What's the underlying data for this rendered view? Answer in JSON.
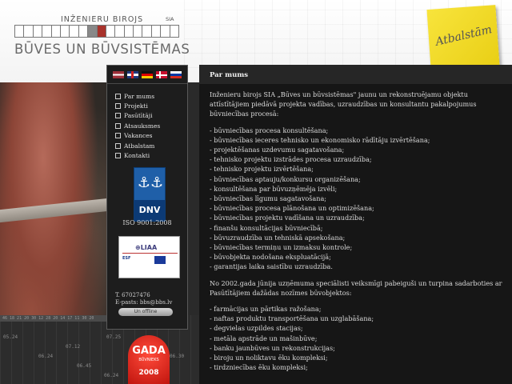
{
  "header": {
    "logo_top": "INŽENIERU BIROJS",
    "logo_sia": "SIA",
    "logo_bottom": "BŪVES UN BŪVSISTĒMAS",
    "sticky_note": "Atbalstām"
  },
  "nav": {
    "flags": [
      "lv",
      "gb",
      "de",
      "dk",
      "ru"
    ],
    "menu": [
      "Par mums",
      "Projekti",
      "Pasūtītāji",
      "Atsauksmes",
      "Vakances",
      "Atbalstam",
      "Kontakti"
    ],
    "dnv": {
      "anchors": "⚓⚓",
      "label": "DNV"
    },
    "iso": "ISO 9001:2008",
    "liaa": {
      "logo": "⊕LIAA",
      "esf": "ESF"
    },
    "contact": {
      "phone": "T. 67027476",
      "email": "E-pasts: bbs@bbs.lv"
    },
    "online_button": "Un offline"
  },
  "badge": {
    "title": "GADA",
    "subtitle": "BŪVNIEKS",
    "year": "2008"
  },
  "content": {
    "title": "Par mums",
    "intro": "Inženieru birojs SIA „Būves un būvsistēmas\" jaunu un rekonstruējamu objektu attīstītājiem piedāvā projekta vadības, uzraudzības un konsultantu pakalpojumus būvniecības procesā:",
    "services": [
      "- būvniecības procesa konsultēšana;",
      "- būvniecības ieceres tehnisko un ekonomisko rādītāju izvērtēšana;",
      "- projektēšanas uzdevumu sagatavošana;",
      "- tehnisko projektu izstrādes procesa uzraudzība;",
      "- tehnisko projektu izvērtēšana;",
      "- būvniecības aptauju/konkursu organizēšana;",
      "- konsultēšana par būvuzņēmēja izvēli;",
      "- būvniecības līgumu sagatavošana;",
      "- būvniecības procesa plānošana un optimizēšana;",
      "- būvniecības projektu vadīšana un uzraudzība;",
      "- finanšu konsultācijas būvniecībā;",
      "- būvuzraudzība un tehniskā apsekošana;",
      "- būvniecības termiņu un izmaksu kontrole;",
      "- būvobjekta nodošana ekspluatācijā;",
      "- garantijas laika saistību uzraudzība."
    ],
    "paragraph2": "No 2002.gada jūnija uzņēmuma speciālisti veiksmīgi pabeiguši un turpina sadarboties ar Pasūtītājiem dažādas nozīmes būvobjektos:",
    "objects": [
      "- farmācijas un pārtikas ražošana;",
      "- naftas produktu transportēšana un uzglabāšana;",
      "- degvielas uzpildes stacijas;",
      "- metāla apstrāde un mašinbūve;",
      "- banku jaunbūves un rekonstrukcijas;",
      "- biroju un noliktavu ēku kompleksi;",
      "- tirdzniecības ēku kompleksi;"
    ]
  },
  "drawing": {
    "ruler": "46 18 21 20 30 12 28 20 14 17 11 30 20",
    "dims": [
      "05.24",
      "07.12",
      "06.24",
      "06.45",
      "07.25",
      "06.30",
      "06.24"
    ]
  }
}
